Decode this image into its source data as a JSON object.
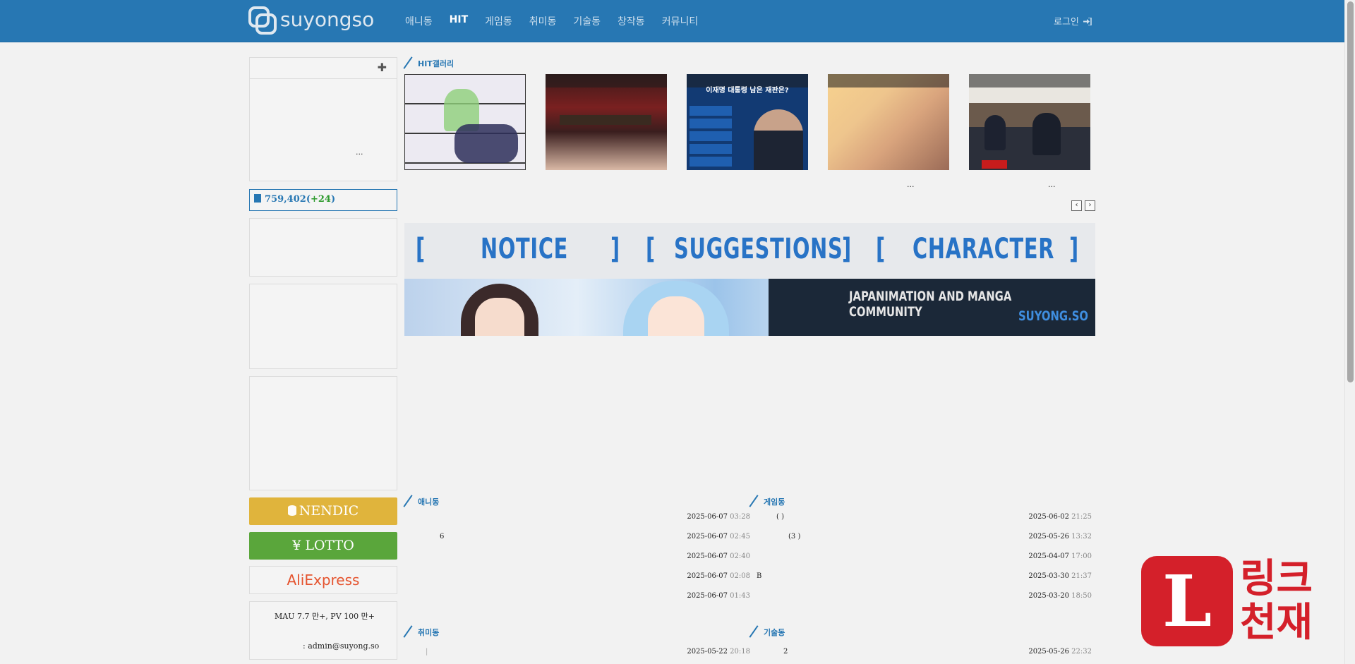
{
  "header": {
    "logo_text": "suyongso",
    "nav": [
      "애니동",
      "HIT",
      "게임동",
      "취미동",
      "기술동",
      "창작동",
      "커뮤니티"
    ],
    "login_label": "로그인"
  },
  "sidebar": {
    "box1_ellipsis": "...",
    "post_count": "759,402",
    "post_count_delta": "+24",
    "nendic_label": "NENDIC",
    "lotto_label": "¥ LOTTO",
    "aliexpress_label": "AliExpress",
    "stats_line": "MAU 7.7 만+,    PV 100 만+",
    "contact": ": admin@suyong.so"
  },
  "hit_gallery": {
    "title": "HIT갤러리",
    "thumb3_headline": "이재명 대통령 남은 재판은?",
    "ellipsis_4": "...",
    "ellipsis_5": "...",
    "prev_label": "‹",
    "next_label": "›"
  },
  "banner": {
    "labels": [
      "[",
      "NOTICE",
      "]",
      "[",
      "SUGGESTIONS",
      "]",
      "[",
      "CHARACTER",
      "]"
    ],
    "tagline": "JAPANIMATION AND MANGA COMMUNITY",
    "site": "SUYONG.SO"
  },
  "boards": {
    "anime": {
      "title": "애니동",
      "rows": [
        {
          "title": "",
          "date": "2025-06-07",
          "time": "03:28"
        },
        {
          "title": "6",
          "date": "2025-06-07",
          "time": "02:45"
        },
        {
          "title": "",
          "date": "2025-06-07",
          "time": "02:40"
        },
        {
          "title": "",
          "date": "2025-06-07",
          "time": "02:08"
        },
        {
          "title": "",
          "date": "2025-06-07",
          "time": "01:43"
        }
      ]
    },
    "game": {
      "title": "게임동",
      "rows": [
        {
          "title": "(    )",
          "date": "2025-06-02",
          "time": "21:25"
        },
        {
          "title": "                  (3      )",
          "date": "2025-05-26",
          "time": "13:32"
        },
        {
          "title": "",
          "date": "2025-04-07",
          "time": "17:00"
        },
        {
          "title": "B",
          "date": "2025-03-30",
          "time": "21:37"
        },
        {
          "title": "",
          "date": "2025-03-20",
          "time": "18:50"
        }
      ]
    },
    "hobby": {
      "title": "취미동",
      "rows": [
        {
          "title": "|",
          "date": "2025-05-22",
          "time": "20:18"
        }
      ]
    },
    "tech": {
      "title": "기술동",
      "rows": [
        {
          "title": "2",
          "date": "2025-05-26",
          "time": "22:32"
        }
      ]
    }
  },
  "watermark": {
    "letter": "L",
    "text_line1": "링크",
    "text_line2": "천재"
  }
}
